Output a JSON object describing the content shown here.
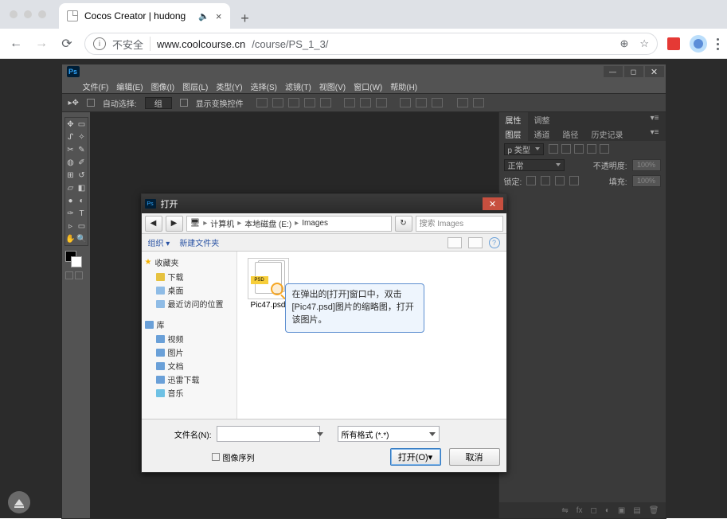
{
  "browser": {
    "tab_title": "Cocos Creator | hudong",
    "tab_speaker": "🔈",
    "insecure_label": "不安全",
    "url_host": "www.coolcourse.cn",
    "url_path": "/course/PS_1_3/"
  },
  "ps": {
    "menus": [
      "文件(F)",
      "编辑(E)",
      "图像(I)",
      "图层(L)",
      "类型(Y)",
      "选择(S)",
      "滤镜(T)",
      "视图(V)",
      "窗口(W)",
      "帮助(H)"
    ],
    "options": {
      "auto_select": "自动选择:",
      "group": "组",
      "show_transform": "显示变换控件"
    },
    "panels": {
      "tab_properties": "属性",
      "tab_adjust": "调整",
      "tab_layers": "图层",
      "tab_channels": "通道",
      "tab_paths": "路径",
      "tab_history": "历史记录",
      "kind_label": "p 类型",
      "blend_mode": "正常",
      "opacity_label": "不透明度:",
      "opacity_value": "100%",
      "lock_label": "锁定:",
      "fill_label": "填充:",
      "fill_value": "100%"
    }
  },
  "dialog": {
    "title": "打开",
    "crumbs": [
      "计算机",
      "本地磁盘 (E:)",
      "Images"
    ],
    "search_placeholder": "搜索 Images",
    "toolbar": {
      "organize": "组织 ▾",
      "new_folder": "新建文件夹"
    },
    "sidebar": {
      "favorites": {
        "head": "收藏夹",
        "items": [
          "下载",
          "桌面",
          "最近访问的位置"
        ]
      },
      "libraries": {
        "head": "库",
        "items": [
          "视频",
          "图片",
          "文档",
          "迅雷下载",
          "音乐"
        ]
      }
    },
    "file": {
      "name": "Pic47.psd",
      "psd_badge": "PSD"
    },
    "tooltip": "在弹出的[打开]窗口中，双击[Pic47.psd]图片的缩略图，打开该图片。",
    "filename_label": "文件名(N):",
    "filter_label": "所有格式 (*.*)",
    "sequence_label": "图像序列",
    "open_btn": "打开(O)",
    "cancel_btn": "取消"
  }
}
